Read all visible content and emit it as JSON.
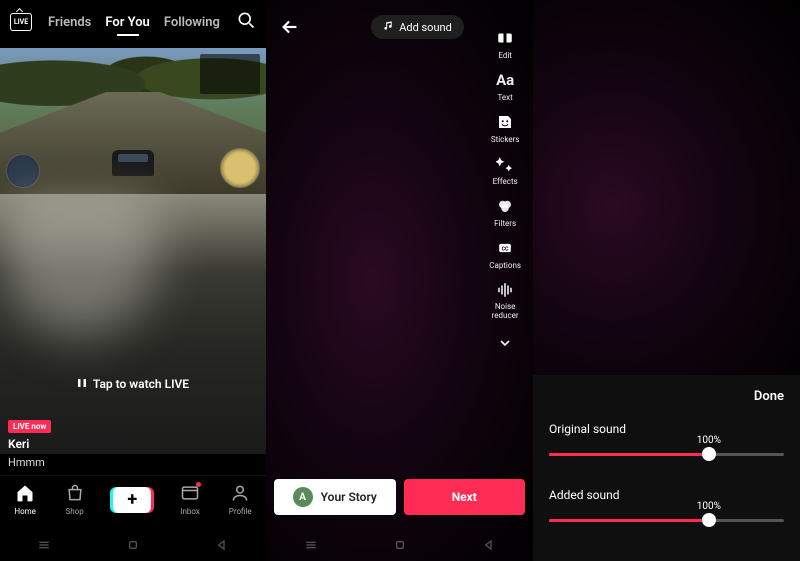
{
  "left": {
    "live_icon_label": "LIVE",
    "tabs": {
      "friends": "Friends",
      "foryou": "For You",
      "following": "Following"
    },
    "tap_live": "Tap to watch LIVE",
    "live_now": "LIVE now",
    "username": "Keri",
    "caption": "Hmmm",
    "nav": {
      "home": "Home",
      "shop": "Shop",
      "inbox": "Inbox",
      "profile": "Profile"
    }
  },
  "mid": {
    "add_sound": "Add sound",
    "tools": {
      "edit": "Edit",
      "text": "Text",
      "stickers": "Stickers",
      "effects": "Effects",
      "filters": "Filters",
      "captions": "Captions",
      "noise": "Noise\nreducer"
    },
    "text_icon": "Aa",
    "your_story": "Your Story",
    "avatar_initial": "A",
    "next": "Next"
  },
  "right": {
    "done": "Done",
    "original_label": "Original sound",
    "original_pct": "100%",
    "original_fill": 68,
    "added_label": "Added sound",
    "added_pct": "100%",
    "added_fill": 68
  }
}
